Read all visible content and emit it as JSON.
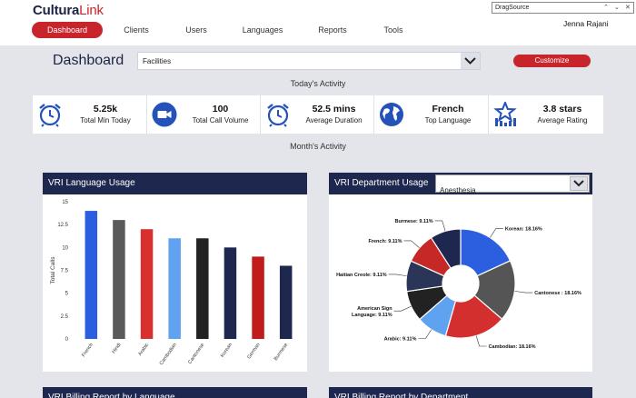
{
  "app": {
    "logo_part1": "Cultura",
    "logo_part2": "Link",
    "user_name": "Jenna Rajani"
  },
  "nav": {
    "items": [
      {
        "label": "Dashboard",
        "active": true
      },
      {
        "label": "Clients",
        "active": false
      },
      {
        "label": "Users",
        "active": false
      },
      {
        "label": "Languages",
        "active": false
      },
      {
        "label": "Reports",
        "active": false
      },
      {
        "label": "Tools",
        "active": false
      }
    ]
  },
  "findbar": {
    "value": "DragSource",
    "up_icon": "chevron-up-icon",
    "down_icon": "chevron-down-icon",
    "close_icon": "close-icon"
  },
  "header": {
    "title": "Dashboard",
    "facility_value": "Facilities",
    "customize_label": "Customize"
  },
  "today": {
    "label": "Today's Activity",
    "stats": [
      {
        "value": "5.25k",
        "label": "Total Min Today",
        "icon": "alarm-clock-icon"
      },
      {
        "value": "100",
        "label": "Total Call Volume",
        "icon": "video-camera-icon"
      },
      {
        "value": "52.5 mins",
        "label": "Average Duration",
        "icon": "alarm-clock-icon"
      },
      {
        "value": "French",
        "label": "Top Language",
        "icon": "globe-icon"
      },
      {
        "value": "3.8 stars",
        "label": "Average Rating",
        "icon": "star-rating-icon"
      }
    ]
  },
  "month": {
    "label": "Month's Activity"
  },
  "language_card": {
    "title": "VRI Language Usage"
  },
  "department_card": {
    "title": "VRI Department Usage",
    "select_value": "Anesthesia"
  },
  "bottom_cards": {
    "left_title": "VRI Billing Report by Language",
    "right_title": "VRI Billing Report by Department"
  },
  "colors": {
    "accent": "#c8242b",
    "navy": "#1e274d",
    "background": "#e3e5ea"
  },
  "chart_data": [
    {
      "type": "bar",
      "title": "",
      "ylabel": "Total Calls",
      "xlabel": "",
      "ylim": [
        0,
        15
      ],
      "yticks": [
        "0",
        "2.5",
        "5",
        "7.5",
        "10",
        "12.5",
        "15"
      ],
      "categories": [
        "French",
        "Hindi",
        "Arabic",
        "Cambodian",
        "Cantonese",
        "Korean",
        "German",
        "Burmese"
      ],
      "values": [
        14,
        13,
        12,
        11,
        11,
        10,
        9,
        8
      ],
      "colors": [
        "#2c5fe0",
        "#5a5a5a",
        "#d8302e",
        "#5ea2f0",
        "#222222",
        "#1e274d",
        "#c21b1b",
        "#1e274d"
      ]
    },
    {
      "type": "pie",
      "donut": true,
      "slices": [
        {
          "label": "Korean: 18.16%",
          "value": 18.16,
          "color": "#2c5fe0"
        },
        {
          "label": "Cantonese : 18.16%",
          "value": 18.16,
          "color": "#555555"
        },
        {
          "label": "Cambodian: 18.16%",
          "value": 18.16,
          "color": "#d32f2f"
        },
        {
          "label": "Arabic: 9.11%",
          "value": 9.11,
          "color": "#5ea2f0"
        },
        {
          "label": "American Sign Language: 9.11%",
          "value": 9.11,
          "color": "#222222"
        },
        {
          "label": "Haitian Creole: 9.11%",
          "value": 9.11,
          "color": "#2a3557"
        },
        {
          "label": "French: 9.11%",
          "value": 9.11,
          "color": "#c62828"
        },
        {
          "label": "Burmese: 9.11%",
          "value": 9.11,
          "color": "#1e274d"
        }
      ]
    }
  ]
}
